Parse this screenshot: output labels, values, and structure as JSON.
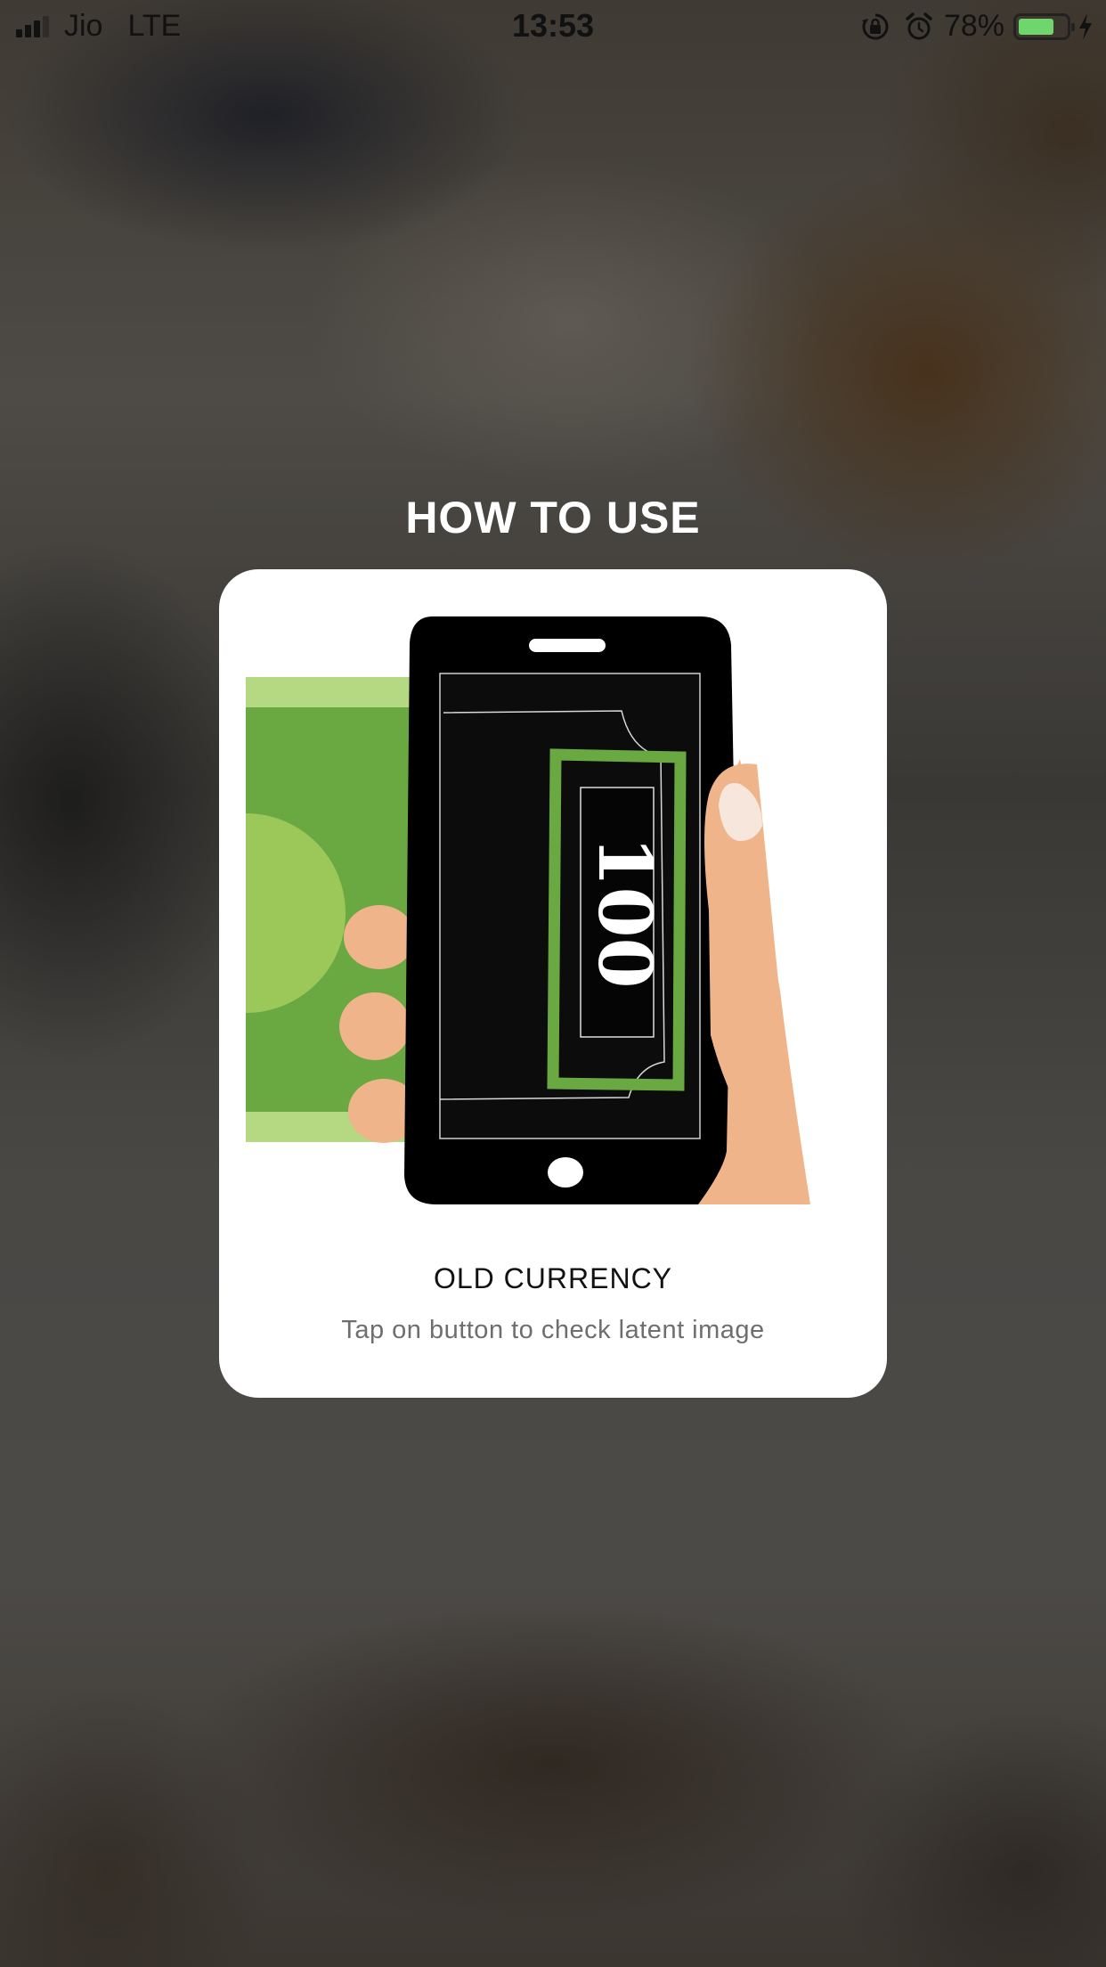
{
  "status_bar": {
    "carrier": "Jio",
    "network": "LTE",
    "time": "13:53",
    "battery_percent": "78%",
    "battery_level": 0.78,
    "icons": [
      "signal-icon",
      "orientation-lock-icon",
      "alarm-icon",
      "battery-icon",
      "charging-icon"
    ]
  },
  "screen": {
    "title": "HOW TO USE"
  },
  "card": {
    "illustration": {
      "note_value": "100",
      "icon": "hand-holding-phone-scanning-note-illustration"
    },
    "caption": "OLD CURRENCY",
    "subtitle": "Tap on button to check latent image"
  },
  "colors": {
    "note_green": "#6aa842",
    "note_light_green": "#b4d982",
    "skin": "#efb48a",
    "phone_black": "#000000",
    "card_bg": "#ffffff",
    "battery_green": "#6fd66d"
  }
}
